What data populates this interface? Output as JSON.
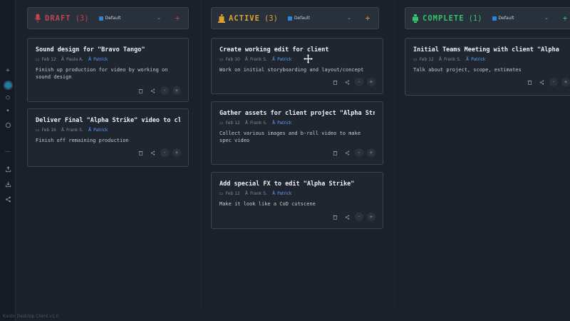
{
  "app": {
    "footer": "Kanbr Desktop Client v1.0"
  },
  "rail": {
    "items": [
      {
        "name": "add-icon",
        "glyph": "+"
      },
      {
        "name": "board-active-icon",
        "glyph": ""
      },
      {
        "name": "circle-icon",
        "glyph": "○"
      },
      {
        "name": "dot-icon",
        "glyph": "•"
      },
      {
        "name": "refresh-icon",
        "glyph": ""
      },
      {
        "name": "upload-icon",
        "glyph": ""
      },
      {
        "name": "download-icon",
        "glyph": ""
      },
      {
        "name": "share-icon",
        "glyph": ""
      }
    ]
  },
  "columns": [
    {
      "title": "DRAFT",
      "count": "(3)",
      "board": "Default",
      "minus": "-",
      "plus": "+",
      "color": "#c0454f",
      "cards": [
        {
          "title": "Sound design for \"Bravo Tango\"",
          "date": "Feb 12",
          "author": "Paula A.",
          "assignee": "Patrick",
          "desc": "Finish up production for video by working on sound design"
        },
        {
          "title": "Deliver Final \"Alpha Strike\" video to client",
          "date": "Feb 16",
          "author": "Frank S.",
          "assignee": "Patrick",
          "desc": "Finish off remaining production"
        }
      ]
    },
    {
      "title": "ACTIVE",
      "count": "(3)",
      "board": "Default",
      "minus": "-",
      "plus": "+",
      "color": "#e0a030",
      "cards": [
        {
          "title": "Create working edit for client",
          "date": "Feb 10",
          "author": "Frank S.",
          "assignee": "Patrick",
          "desc": "Work on initial storyboarding and layout/concept"
        },
        {
          "title": "Gather assets for client project \"Alpha Strike\"",
          "date": "Feb 12",
          "author": "Frank S.",
          "assignee": "Patrick",
          "desc": "Collect various images and b-roll video to make spec video"
        },
        {
          "title": "Add special FX to edit \"Alpha Strike\"",
          "date": "Feb 12",
          "author": "Frank S.",
          "assignee": "Patrick",
          "desc": "Make it look like a CoD cutscene"
        }
      ]
    },
    {
      "title": "COMPLETE",
      "count": "(1)",
      "board": "Default",
      "minus": "-",
      "plus": "+",
      "color": "#35c46a",
      "cards": [
        {
          "title": "Initial Teams Meeting with client \"Alpha Strike\"",
          "date": "Feb 12",
          "author": "Frank S.",
          "assignee": "Patrick",
          "desc": "Talk about project, scope, estimates"
        }
      ]
    }
  ],
  "card_actions": {
    "delete": "trash-icon",
    "share": "share-icon",
    "move_back": "-",
    "move_forward": "+"
  },
  "meta_icons": {
    "date": "▭",
    "author": "Å",
    "assignee": "Å"
  }
}
